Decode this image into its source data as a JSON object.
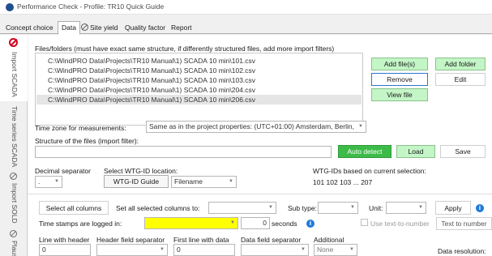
{
  "window": {
    "title": "Performance Check - Profile: TR10 Quick Guide"
  },
  "tabs": [
    {
      "label": "Concept choice"
    },
    {
      "label": "Data"
    },
    {
      "label": "Site yield"
    },
    {
      "label": "Quality factor"
    },
    {
      "label": "Report"
    }
  ],
  "side_tabs": [
    {
      "label": "Import SCADA"
    },
    {
      "label": "Time series SCADA"
    },
    {
      "label": "Import SOLD"
    },
    {
      "label": "Plaus"
    }
  ],
  "files": {
    "header": "Files/folders (must have exact same structure, if differently structured files, add more import filters)",
    "items": [
      "C:\\WindPRO Data\\Projects\\TR10 Manual\\1) SCADA 10 min\\101.csv",
      "C:\\WindPRO Data\\Projects\\TR10 Manual\\1) SCADA 10 min\\102.csv",
      "C:\\WindPRO Data\\Projects\\TR10 Manual\\1) SCADA 10 min\\103.csv",
      "C:\\WindPRO Data\\Projects\\TR10 Manual\\1) SCADA 10 min\\204.csv",
      "C:\\WindPRO Data\\Projects\\TR10 Manual\\1) SCADA 10 min\\206.csv"
    ],
    "selected_index": 4,
    "buttons": {
      "add_files": "Add file(s)",
      "add_folder": "Add folder",
      "remove": "Remove",
      "edit": "Edit",
      "view_file": "View file"
    }
  },
  "timezone": {
    "label": "Time zone for measurements:",
    "value": "Same as in the project properties: (UTC+01:00) Amsterdam, Berlin,"
  },
  "structure": {
    "label": "Structure of the files (import filter):",
    "value": "",
    "auto_detect": "Auto detect",
    "load": "Load",
    "save": "Save"
  },
  "decimal": {
    "label": "Decimal separator",
    "value": "."
  },
  "wtg": {
    "label": "Select WTG-ID location:",
    "guide_button": "WTG-ID Guide",
    "location_value": "Filename",
    "ids_label": "WTG-IDs based on current selection:",
    "ids_value": "101 102 103 ... 207"
  },
  "columns": {
    "select_all": "Select all columns",
    "set_label": "Set all selected columns to:",
    "set_value": "",
    "subtype_label": "Sub type:",
    "subtype_value": "",
    "unit_label": "Unit:",
    "unit_value": "",
    "apply": "Apply"
  },
  "timestamps": {
    "label": "Time stamps are logged in:",
    "value": "",
    "offset_value": "0",
    "offset_unit": "seconds",
    "use_text_label": "Use text-to-number",
    "text_to_number": "Text to number"
  },
  "parsing": {
    "line_header_label": "Line with header",
    "line_header_value": "0",
    "header_sep_label": "Header field separator",
    "header_sep_value": "",
    "first_line_label": "First line with data",
    "first_line_value": "0",
    "data_sep_label": "Data field separator",
    "data_sep_value": "",
    "additional_label": "Additional",
    "additional_value": "None",
    "resolution_label": "Data resolution:"
  },
  "colors": {
    "accent_green": "#c3f5c6",
    "auto_detect_green": "#3dbb49",
    "highlight_yellow": "#ffff00",
    "error_red": "#d0021b",
    "info_blue": "#1f7ad9"
  }
}
